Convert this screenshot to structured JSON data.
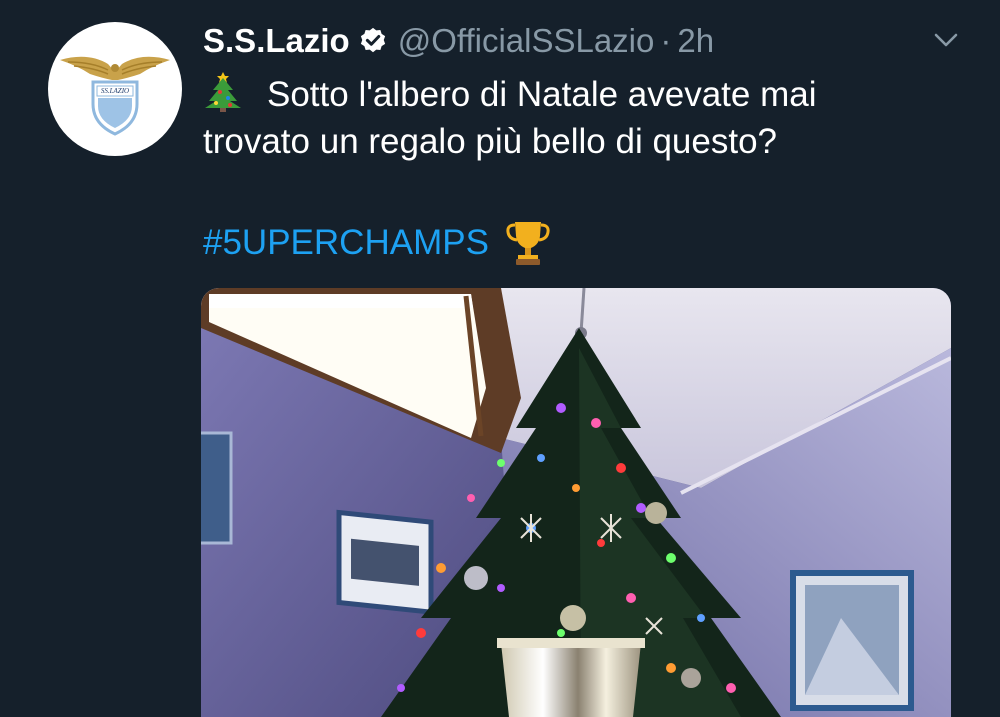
{
  "tweet": {
    "author_name": "S.S.Lazio",
    "handle": "@OfficialSSLazio",
    "separator": "·",
    "time": "2h",
    "text_line1": "Sotto l'albero di Natale avevate mai",
    "text_line2": "trovato un regalo più bello di questo?",
    "hashtag": "#5UPERCHAMPS",
    "avatar_crest_text": "SS.LAZIO"
  },
  "icons": {
    "verified": "verified-badge-icon",
    "menu": "chevron-down-icon",
    "tree_emoji": "christmas-tree-icon",
    "trophy_emoji": "trophy-icon"
  },
  "colors": {
    "background": "#15202b",
    "link": "#1da1f2",
    "secondary_text": "#8899a6"
  }
}
